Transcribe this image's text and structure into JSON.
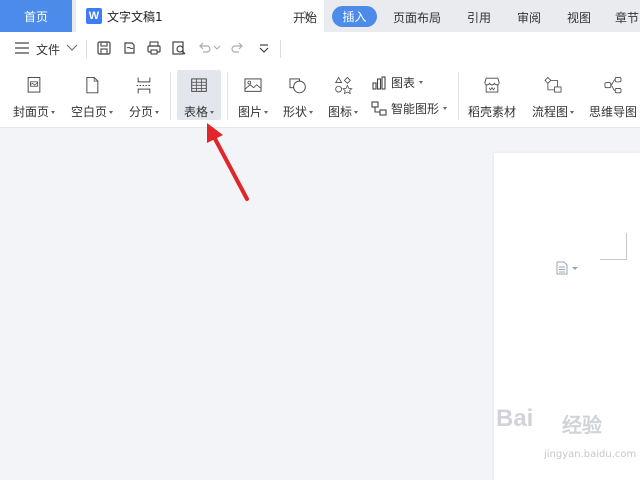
{
  "tabs": {
    "home": "首页",
    "document": "文字文稿1"
  },
  "menu": {
    "file": "文件",
    "items": [
      "开始",
      "插入",
      "页面布局",
      "引用",
      "审阅",
      "视图",
      "章节"
    ],
    "active": "插入"
  },
  "ribbon": {
    "cover": "封面页",
    "blank": "空白页",
    "pagebreak": "分页",
    "table": "表格",
    "picture": "图片",
    "shape": "形状",
    "icon": "图标",
    "chart": "图表",
    "smartart": "智能图形",
    "material": "稻壳素材",
    "flowchart": "流程图",
    "mindmap": "思维导图"
  },
  "watermark": {
    "brand": "Bai",
    "brand2": "经验",
    "url": "jingyan.baidu.com"
  },
  "colors": {
    "accent": "#4d8bea",
    "annotation_arrow": "#e0262b"
  }
}
